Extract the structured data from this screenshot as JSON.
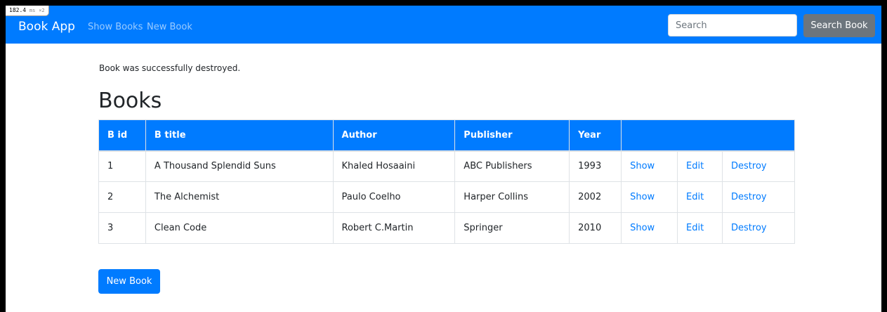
{
  "perf": {
    "value": "182.4",
    "unit": "ms",
    "scale": "×2"
  },
  "navbar": {
    "brand": "Book App",
    "links": [
      "Show Books",
      "New Book"
    ],
    "search_placeholder": "Search",
    "search_button": "Search Book"
  },
  "notice": "Book was successfully destroyed.",
  "page_title": "Books",
  "table": {
    "headers": [
      "B id",
      "B title",
      "Author",
      "Publisher",
      "Year",
      ""
    ],
    "rows": [
      {
        "id": "1",
        "title": "A Thousand Splendid Suns",
        "author": "Khaled Hosaaini",
        "publisher": "ABC Publishers",
        "year": "1993"
      },
      {
        "id": "2",
        "title": "The Alchemist",
        "author": "Paulo Coelho",
        "publisher": "Harper Collins",
        "year": "2002"
      },
      {
        "id": "3",
        "title": "Clean Code",
        "author": "Robert C.Martin",
        "publisher": "Springer",
        "year": "2010"
      }
    ],
    "actions": {
      "show": "Show",
      "edit": "Edit",
      "destroy": "Destroy"
    }
  },
  "new_book_button": "New Book",
  "colors": {
    "primary": "#007bff",
    "secondary": "#6c757d",
    "border": "#dee2e6",
    "text": "#212529"
  }
}
